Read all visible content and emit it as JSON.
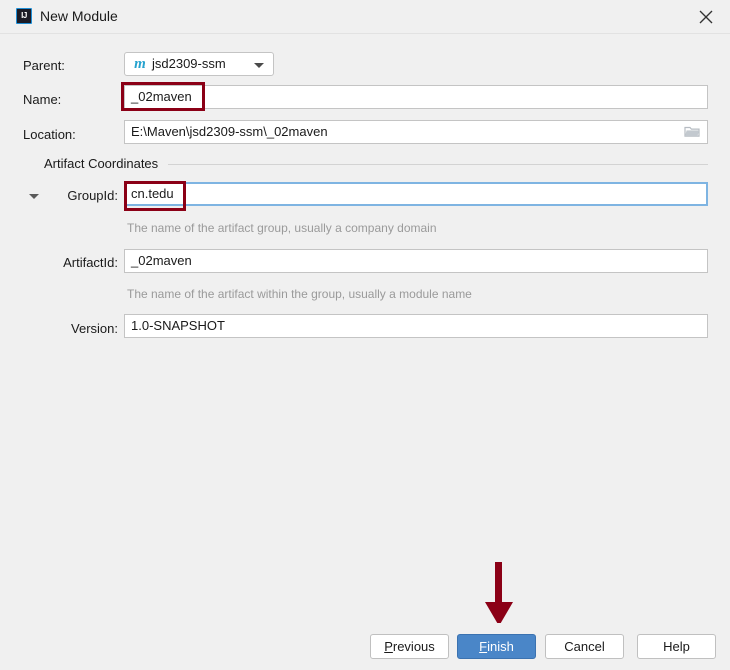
{
  "window": {
    "title": "New Module",
    "app_icon": "intellij-idea-icon",
    "close_icon": "close-icon"
  },
  "form": {
    "parent": {
      "label": "Parent:",
      "icon": "maven-icon",
      "value": "jsd2309-ssm",
      "chevron": "chevron-down-icon"
    },
    "name": {
      "label": "Name:",
      "value": "_02maven"
    },
    "location": {
      "label": "Location:",
      "value": "E:\\Maven\\jsd2309-ssm\\_02maven",
      "browse_icon": "folder-icon"
    },
    "artifact_coordinates": {
      "label": "Artifact Coordinates",
      "expanded": true,
      "toggle_icon": "triangle-down-icon",
      "group_id": {
        "label": "GroupId:",
        "value": "cn.tedu",
        "hint": "The name of the artifact group, usually a company domain",
        "focused": true
      },
      "artifact_id": {
        "label": "ArtifactId:",
        "value": "_02maven",
        "hint": "The name of the artifact within the group, usually a module name"
      },
      "version": {
        "label": "Version:",
        "value": "1.0-SNAPSHOT"
      }
    }
  },
  "annotations": {
    "highlight_color": "#8B0016",
    "boxes": [
      "name-field-highlight",
      "group-id-field-highlight"
    ],
    "arrow": "finish-button-arrow"
  },
  "buttons": {
    "previous": {
      "label": "Previous",
      "mnemonic": "P"
    },
    "finish": {
      "label": "Finish",
      "mnemonic": "F",
      "primary": true
    },
    "cancel": {
      "label": "Cancel"
    },
    "help": {
      "label": "Help"
    }
  }
}
